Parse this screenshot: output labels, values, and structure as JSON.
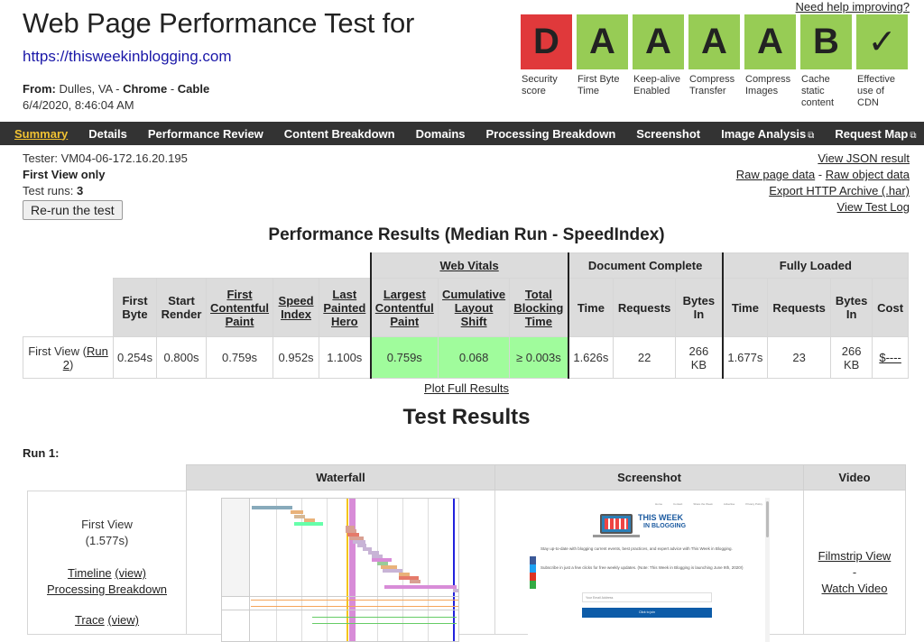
{
  "header": {
    "title": "Web Page Performance Test for",
    "url": "https://thisweekinblogging.com",
    "from_label": "From:",
    "location": "Dulles, VA",
    "browser": "Chrome",
    "connection": "Cable",
    "sep": "-",
    "datetime": "6/4/2020, 8:46:04 AM",
    "help_link": "Need help improving?"
  },
  "grades": [
    {
      "grade": "D",
      "label": "Security score",
      "status_color": "#e0393b"
    },
    {
      "grade": "A",
      "label": "First Byte Time",
      "status_color": "#97cc55"
    },
    {
      "grade": "A",
      "label": "Keep-alive Enabled",
      "status_color": "#97cc55"
    },
    {
      "grade": "A",
      "label": "Compress Transfer",
      "status_color": "#97cc55"
    },
    {
      "grade": "A",
      "label": "Compress Images",
      "status_color": "#97cc55"
    },
    {
      "grade": "B",
      "label": "Cache static content",
      "status_color": "#97cc55"
    },
    {
      "grade": "✓",
      "label": "Effective use of CDN",
      "status_color": "#97cc55"
    }
  ],
  "nav": {
    "items": [
      {
        "label": "Summary",
        "active": true
      },
      {
        "label": "Details"
      },
      {
        "label": "Performance Review"
      },
      {
        "label": "Content Breakdown"
      },
      {
        "label": "Domains"
      },
      {
        "label": "Processing Breakdown"
      },
      {
        "label": "Screenshot"
      },
      {
        "label": "Image Analysis",
        "external": true
      },
      {
        "label": "Request Map",
        "external": true
      }
    ],
    "external_icon": "⧉",
    "active_color": "#f1c232"
  },
  "test_info": {
    "tester": "Tester: VM04-06-172.16.20.195",
    "view_mode": "First View only",
    "runs_label": "Test runs:",
    "runs_value": "3",
    "rerun_button": "Re-run the test"
  },
  "links": {
    "json": "View JSON result",
    "raw_page": "Raw page data",
    "dash": "-",
    "raw_object": "Raw object data",
    "har": "Export HTTP Archive (.har)",
    "log": "View Test Log"
  },
  "perf": {
    "heading": "Performance Results (Median Run - SpeedIndex)",
    "groups": {
      "web_vitals": "Web Vitals",
      "doc_complete": "Document Complete",
      "fully_loaded": "Fully Loaded"
    },
    "columns": {
      "first_byte": "First Byte",
      "start_render": "Start Render",
      "fcp": "First Contentful Paint",
      "speed_index": "Speed Index",
      "lph": "Last Painted Hero",
      "lcp": "Largest Contentful Paint",
      "cls": "Cumulative Layout Shift",
      "tbt": "Total Blocking Time",
      "time": "Time",
      "requests": "Requests",
      "bytes_in": "Bytes In",
      "cost": "Cost"
    },
    "row": {
      "label": "First View (",
      "run_link": "Run 2",
      "label_end": ")",
      "first_byte": "0.254s",
      "start_render": "0.800s",
      "fcp": "0.759s",
      "speed_index": "0.952s",
      "lph": "1.100s",
      "lcp": "0.759s",
      "cls": "0.068",
      "tbt": "≥ 0.003s",
      "doc_time": "1.626s",
      "doc_requests": "22",
      "doc_bytes": "266 KB",
      "fl_time": "1.677s",
      "fl_requests": "23",
      "fl_bytes": "266 KB",
      "cost": "$----"
    },
    "vital_color": "#a0fc9c",
    "plot_link": "Plot Full Results"
  },
  "results": {
    "heading": "Test Results",
    "run_label": "Run 1:",
    "columns": {
      "waterfall": "Waterfall",
      "screenshot": "Screenshot",
      "video": "Video"
    },
    "first_view": "First View",
    "first_view_time": "(1.577s)",
    "timeline": "Timeline",
    "view": "(view)",
    "processing": "Processing Breakdown",
    "trace": "Trace",
    "filmstrip": "Filmstrip View",
    "dash": "-",
    "watch_video": "Watch Video",
    "screenshot_text": {
      "nav": [
        "Home",
        "Contact",
        "Share the Week",
        "Advertise",
        "Privacy Policy"
      ],
      "logo_line1": "THIS WEEK",
      "logo_line2": "IN BLOGGING",
      "para1": "Stay up-to-date with blogging current events, best practices, and expert advice with This Week in Blogging.",
      "para2": "Subscribe in just a few clicks for free weekly updates. (Note: This Week in Blogging is launching June 9th, 2020!)",
      "email_placeholder": "Your Email Address",
      "join_button": "Click to join"
    }
  }
}
